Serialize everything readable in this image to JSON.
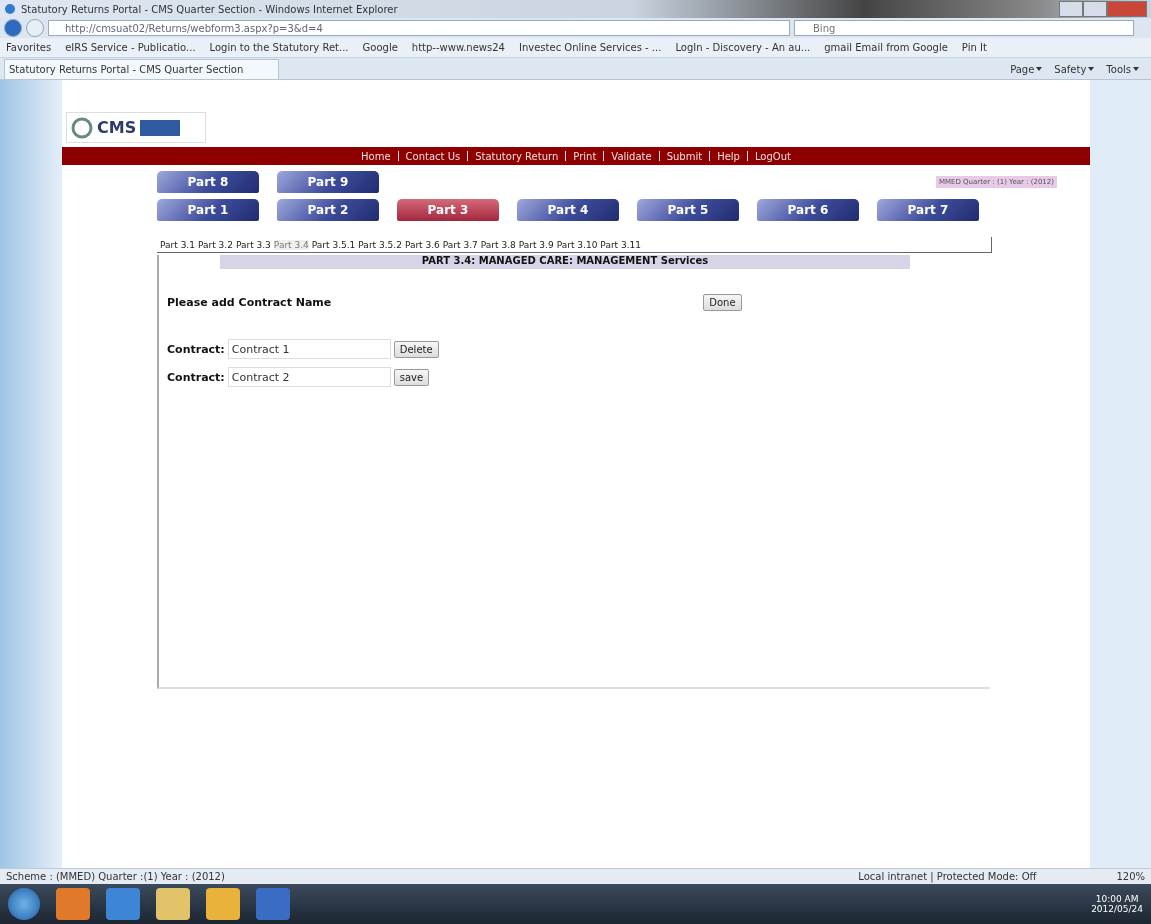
{
  "window": {
    "title": "Statutory Returns Portal - CMS Quarter Section - Windows Internet Explorer"
  },
  "address_bar": {
    "url": "http://cmsuat02/Returns/webform3.aspx?p=3&d=4",
    "search_placeholder": "Bing"
  },
  "favorites": [
    "Favorites",
    "eIRS Service - Publicatio...",
    "Login to the Statutory Ret...",
    "Google",
    "http--www.news24",
    "Investec Online Services - ...",
    "LogIn - Discovery - An au...",
    "gmail Email from Google",
    "Pin It"
  ],
  "browser_tab": {
    "title": "Statutory Returns Portal - CMS Quarter Section"
  },
  "command_bar": [
    "Page",
    "Safety",
    "Tools"
  ],
  "page": {
    "logo": "CMS",
    "nav": [
      "Home",
      "Contact Us",
      "Statutory Return",
      "Print",
      "Validate",
      "Submit",
      "Help",
      "LogOut"
    ],
    "period": "MMED Quarter : (1) Year : (2012)",
    "part_rows": [
      [
        {
          "label": "Part 8",
          "selected": false
        },
        {
          "label": "Part 9",
          "selected": false
        }
      ],
      [
        {
          "label": "Part 1",
          "selected": false
        },
        {
          "label": "Part 2",
          "selected": false
        },
        {
          "label": "Part 3",
          "selected": true
        },
        {
          "label": "Part 4",
          "selected": false
        },
        {
          "label": "Part 5",
          "selected": false
        },
        {
          "label": "Part 6",
          "selected": false
        },
        {
          "label": "Part 7",
          "selected": false
        }
      ]
    ],
    "subparts": [
      {
        "label": "Part 3.1",
        "selected": false
      },
      {
        "label": "Part 3.2",
        "selected": false
      },
      {
        "label": "Part 3.3",
        "selected": false
      },
      {
        "label": "Part 3.4",
        "selected": true
      },
      {
        "label": "Part 3.5.1",
        "selected": false
      },
      {
        "label": "Part 3.5.2",
        "selected": false
      },
      {
        "label": "Part 3.6",
        "selected": false
      },
      {
        "label": "Part 3.7",
        "selected": false
      },
      {
        "label": "Part 3.8",
        "selected": false
      },
      {
        "label": "Part 3.9",
        "selected": false
      },
      {
        "label": "Part 3.10",
        "selected": false
      },
      {
        "label": "Part 3.11",
        "selected": false
      }
    ],
    "heading": "PART 3.4: MANAGED CARE: MANAGEMENT Services",
    "prompt": "Please add Contract Name",
    "done_button": "Done",
    "contracts": [
      {
        "label": "Contract:",
        "value": "Contract 1",
        "button": "Delete"
      },
      {
        "label": "Contract:",
        "value": "Contract 2",
        "button": "save"
      }
    ]
  },
  "status_bar": {
    "left": "Scheme : (MMED) Quarter :(1) Year : (2012)",
    "zone": "Local intranet | Protected Mode: Off",
    "zoom": "120%"
  },
  "taskbar": {
    "time": "10:00 AM",
    "date": "2012/05/24"
  }
}
